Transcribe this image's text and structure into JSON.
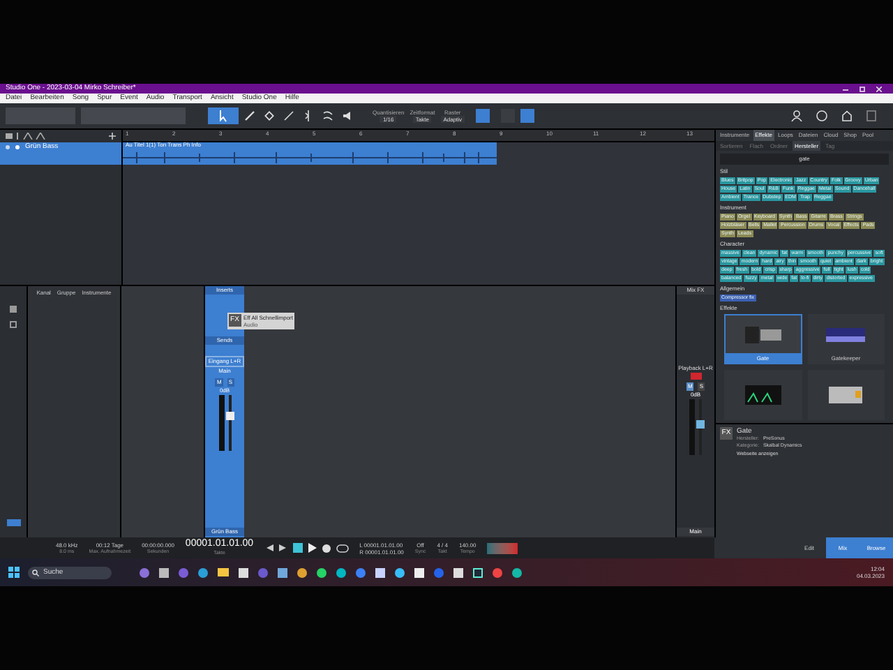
{
  "window": {
    "title": "Studio One - 2023-03-04 Mirko Schreiber*"
  },
  "menu": [
    "Datei",
    "Bearbeiten",
    "Song",
    "Spur",
    "Event",
    "Audio",
    "Transport",
    "Ansicht",
    "Studio One",
    "Hilfe"
  ],
  "toolbar": {
    "fields": [
      {
        "label": "Quantisieren",
        "value": "1/16"
      },
      {
        "label": "Zeitformat",
        "value": "Takte"
      },
      {
        "label": "Raster",
        "value": "Adaptiv"
      }
    ],
    "tools": [
      {
        "kind": "arrow",
        "selected": true
      },
      {
        "kind": "pen",
        "selected": false
      },
      {
        "kind": "eraser",
        "selected": false
      },
      {
        "kind": "line",
        "selected": false
      },
      {
        "kind": "split",
        "selected": false
      },
      {
        "kind": "bend",
        "selected": false
      },
      {
        "kind": "speaker",
        "selected": false
      }
    ]
  },
  "track": {
    "name": "Grün Bass",
    "clip": "Au Titel 1(1) Ton Trans Ph Info"
  },
  "ruler": [
    "1",
    "2",
    "3",
    "4",
    "5",
    "6",
    "7",
    "8",
    "9",
    "10",
    "11",
    "12",
    "13"
  ],
  "browser": {
    "tabs": [
      {
        "label": "Instrumente",
        "selected": false
      },
      {
        "label": "Effekte",
        "selected": true
      },
      {
        "label": "Loops",
        "selected": false
      },
      {
        "label": "Dateien",
        "selected": false
      },
      {
        "label": "Cloud",
        "selected": false
      },
      {
        "label": "Shop",
        "selected": false
      },
      {
        "label": "Pool",
        "selected": false
      }
    ],
    "subtabs": [
      {
        "label": "Sortieren",
        "selected": false
      },
      {
        "label": "Flach",
        "selected": false
      },
      {
        "label": "Ordner",
        "selected": false
      },
      {
        "label": "Hersteller",
        "selected": true
      },
      {
        "label": "Tag",
        "selected": false
      }
    ],
    "search": {
      "value": "gate"
    },
    "tag_groups": [
      {
        "title": "Stil",
        "color": "#2a97a0",
        "tags": [
          "Blues",
          "Britpop",
          "Pop",
          "Electronic",
          "Jazz",
          "Country",
          "Folk",
          "Groovy",
          "Urban",
          "House",
          "Latin",
          "Soul",
          "R&B",
          "Funk",
          "Reggae",
          "Metal",
          "Sound",
          "Dancehall",
          "Ambient",
          "Trance",
          "Dubstep",
          "EDM",
          "Trap",
          "Reggae"
        ]
      },
      {
        "title": "Instrument",
        "color": "#8b8a55",
        "tags": [
          "Piano",
          "Orgel",
          "Keyboard",
          "Synth",
          "Bass",
          "Gitarre",
          "Brass",
          "Strings",
          "Holzbläser",
          "Bells",
          "Mallet",
          "Percussion",
          "Drums",
          "Vocal",
          "Effects",
          "Pads",
          "Synth",
          "Leads"
        ]
      },
      {
        "title": "Character",
        "color": "#2a97a0",
        "tags": [
          "massive",
          "clean",
          "dynamic",
          "fat",
          "warm",
          "smooth",
          "punchy",
          "percussive",
          "soft",
          "vintage",
          "modern",
          "hard",
          "airy",
          "thin",
          "smooth",
          "quiet",
          "ambient",
          "dark",
          "bright",
          "deep",
          "fresh",
          "bold",
          "crisp",
          "sharp",
          "aggressive",
          "full",
          "tight",
          "lush",
          "cold",
          "balanced",
          "fuzzy",
          "metal",
          "wide",
          "fat",
          "lo-fi",
          "dirty",
          "distorted",
          "expressive"
        ]
      },
      {
        "title": "Allgemein",
        "color": "#3b5fb0",
        "tags": [
          "Compressor fix"
        ]
      }
    ],
    "effects_title": "Effekte",
    "effects": [
      {
        "kind": "rack",
        "label": "Gate",
        "selected": true
      },
      {
        "kind": "lights",
        "label": "Gatekeeper",
        "selected": false
      },
      {
        "kind": "display",
        "selected": false
      },
      {
        "kind": "silver",
        "selected": false
      }
    ],
    "info": {
      "badge": "FX",
      "name": "Gate",
      "lines": [
        {
          "label": "Hersteller:",
          "value": "PreSonus"
        },
        {
          "label": "Kategorie:",
          "value": "Skalbal Dynamics"
        }
      ],
      "link": "Webseite anzeigen"
    }
  },
  "mixer": {
    "headers": [
      "Kanal",
      "Gruppe",
      "Instrumente"
    ],
    "channel": {
      "insert_label": "Inserts",
      "tooltip": {
        "badge": "FX",
        "title": "Eff All Schnellimport",
        "subtitle": "Audio"
      },
      "sends_label": "Sends",
      "input": "Eingang L+R",
      "output": "Main",
      "mute": "M",
      "solo": "S",
      "volume": "0dB",
      "level": 0.65,
      "name": "Grün Bass"
    },
    "main": {
      "fx_label": "Mix FX",
      "input": "Playback L+R",
      "mute": "M",
      "solo": "S",
      "volume": "0dB",
      "level": 0.55,
      "name": "Main"
    }
  },
  "transport": {
    "rate": "48.0 kHz",
    "latency": "8.0 ms",
    "days": "00:12 Tage",
    "days_label": "Max. Aufnahmezeit",
    "time": "00:00:00.000",
    "time_label": "Sekunden",
    "bars": "00001.01.01.00",
    "bars_label": "Takte",
    "left": "L 00001.01.01.00",
    "right": "R 00001.01.01.00",
    "sync": "Off",
    "sync_label": "Sync",
    "signature": "4 / 4",
    "signature_label": "Takt",
    "tempo": "140.00",
    "tempo_label": "Tempo"
  },
  "views": [
    {
      "label": "Edit",
      "selected": false
    },
    {
      "label": "Mix",
      "selected": true
    },
    {
      "label": "Browse",
      "selected": true
    }
  ],
  "taskbar": {
    "search": "Suche",
    "time": "12:04",
    "date": "04.03.2023"
  }
}
